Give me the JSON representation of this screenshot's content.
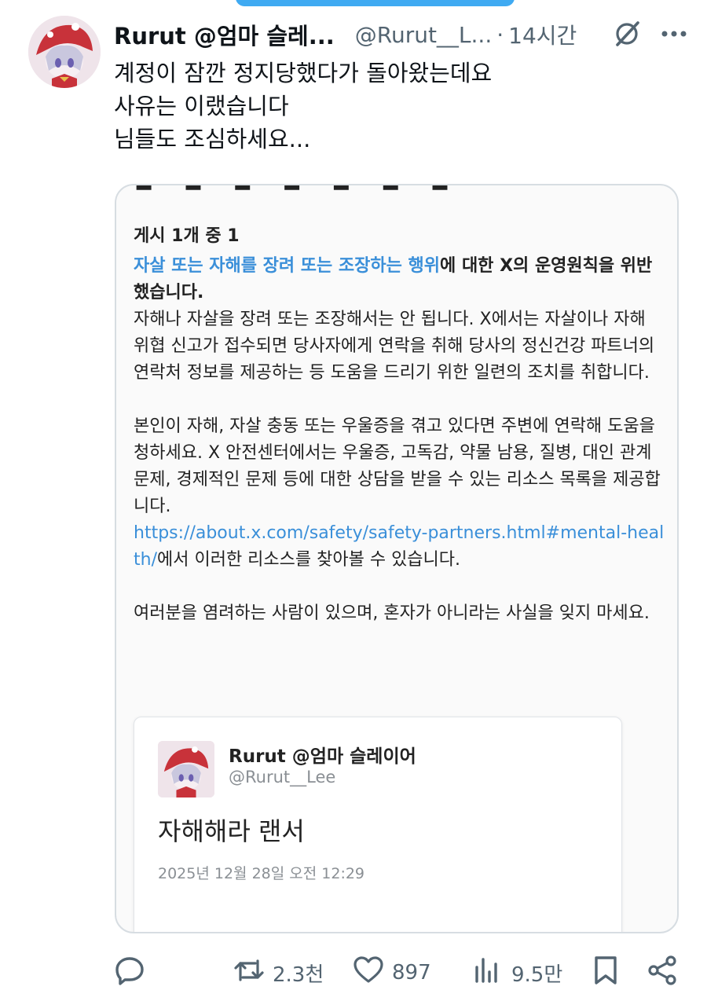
{
  "header": {
    "display_name": "Rurut @엄마 슬레...",
    "handle": "@Rurut__L...",
    "dot": "·",
    "time": "14시간"
  },
  "tweet": {
    "lines": [
      "계정이 잠깐 정지당했다가 돌아왔는데요",
      "사유는 이랬습니다",
      "님들도 조심하세요..."
    ]
  },
  "notice": {
    "count": "게시 1개 중 1",
    "violation_link": "자살 또는 자해를 장려 또는 조장하는 행위",
    "violation_rest": "에 대한 X의 운영원칙을 위반했습니다.",
    "para1": "자해나 자살을 장려 또는 조장해서는 안 됩니다. X에서는 자살이나 자해 위협 신고가 접수되면 당사자에게 연락을 취해 당사의 정신건강 파트너의 연락처 정보를 제공하는 등 도움을 드리기 위한 일련의 조치를 취합니다.",
    "para2": "본인이 자해, 자살 충동 또는 우울증을 겪고 있다면 주변에 연락해 도움을 청하세요. X 안전센터에서는 우울증, 고독감, 약물 남용, 질병, 대인 관계 문제, 경제적인 문제 등에 대한 상담을 받을 수 있는 리소스 목록을 제공합니다.",
    "url": "https://about.x.com/safety/safety-partners.html#mental-health/",
    "url_suffix": "에서 이러한 리소스를 찾아볼 수 있습니다.",
    "para3": "여러분을 염려하는 사람이 있으며, 혼자가 아니라는 사실을 잊지 마세요."
  },
  "quoted": {
    "name": "Rurut @엄마 슬레이어",
    "handle": "@Rurut__Lee",
    "text": "자해해라 랜서",
    "date": "2025년 12월 28일 오전 12:29"
  },
  "actions": {
    "reposts": "2.3천",
    "likes": "897",
    "views": "9.5만"
  },
  "icons": {
    "grok": "grok-icon",
    "more": "more-icon",
    "reply": "reply-icon",
    "repost": "repost-icon",
    "like": "like-icon",
    "views": "views-icon",
    "bookmark": "bookmark-icon",
    "share": "share-icon"
  },
  "colors": {
    "link": "#3a8fd9",
    "secondary_text": "#536471",
    "primary_text": "#0f1419"
  }
}
